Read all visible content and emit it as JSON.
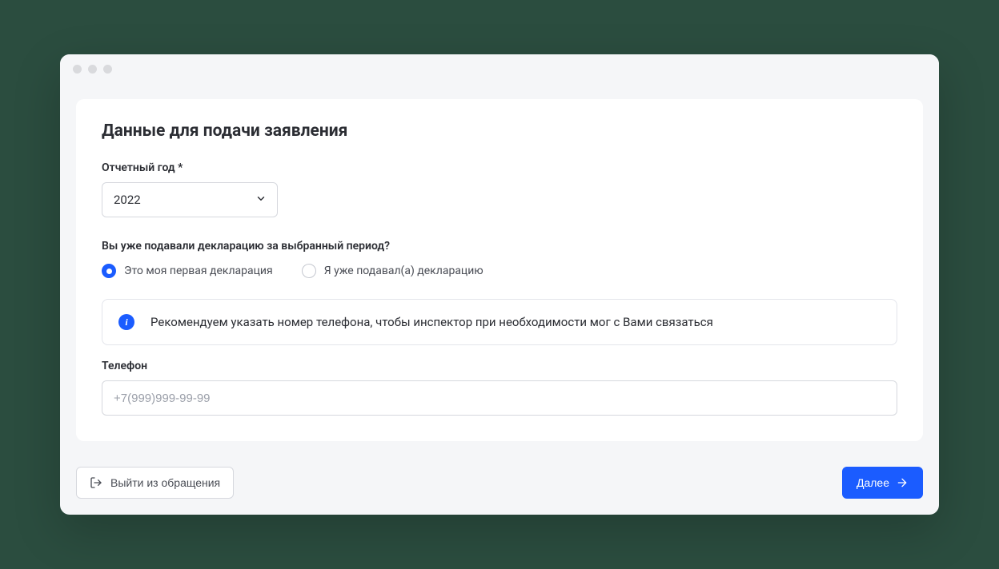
{
  "card": {
    "title": "Данные для подачи заявления"
  },
  "year": {
    "label": "Отчетный год *",
    "value": "2022"
  },
  "declaration_question": {
    "label": "Вы уже подавали декларацию за выбранный период?",
    "options": {
      "first": "Это моя первая декларация",
      "already": "Я уже подавал(а) декларацию"
    },
    "selected": "first"
  },
  "info": {
    "text": "Рекомендуем указать номер телефона, чтобы инспектор при необходимости мог с Вами связаться"
  },
  "phone": {
    "label": "Телефон",
    "placeholder": "+7(999)999-99-99",
    "value": ""
  },
  "buttons": {
    "exit": "Выйти из обращения",
    "next": "Далее"
  }
}
